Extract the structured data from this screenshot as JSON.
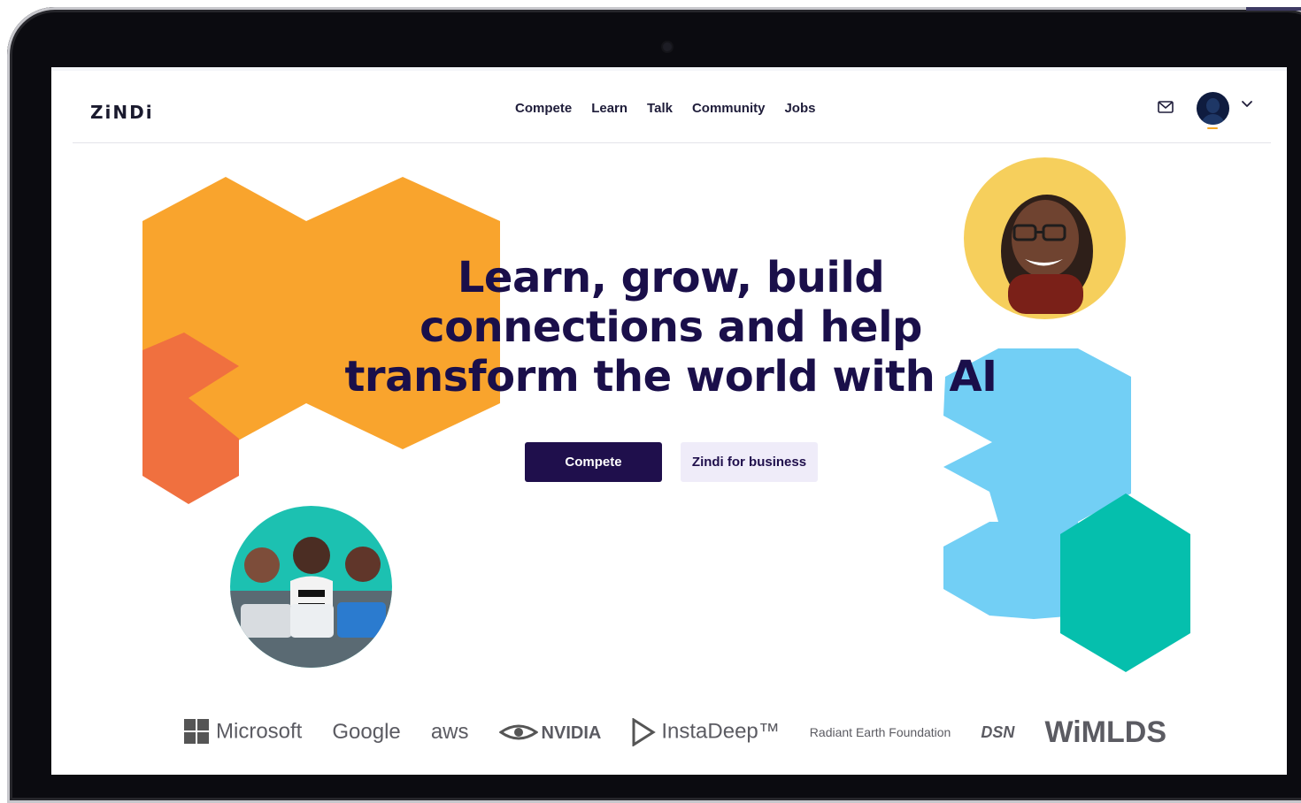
{
  "logo": {
    "text": "ZiNDi"
  },
  "nav": {
    "links": [
      "Compete",
      "Learn",
      "Talk",
      "Community",
      "Jobs"
    ]
  },
  "hero": {
    "headline": "Learn, grow, build connections and help transform the world with AI",
    "primary_button": "Compete",
    "secondary_button": "Zindi for business"
  },
  "partners": [
    "Microsoft",
    "Google",
    "aws",
    "NVIDIA",
    "InstaDeep™",
    "Radiant Earth Foundation",
    "DSN",
    "WiMLDS"
  ],
  "colors": {
    "orange": "#f9a42d",
    "coral": "#f0703f",
    "sky": "#72cff5",
    "teal": "#05bfad",
    "navy": "#1f0f4c"
  },
  "icons": [
    "mail-icon",
    "chevron-down-icon"
  ]
}
